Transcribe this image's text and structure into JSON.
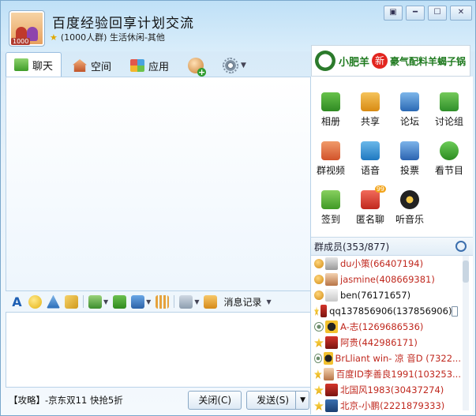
{
  "header": {
    "title": "百度经验回享计划交流",
    "avatar_badge": "1000",
    "group_info": "(1000人群) 生活休闲-其他"
  },
  "window_buttons": [
    "▣",
    "━",
    "☐",
    "✕"
  ],
  "tabs": [
    {
      "label": "聊天",
      "icon": "chat-icon"
    },
    {
      "label": "空间",
      "icon": "house-icon"
    },
    {
      "label": "应用",
      "icon": "apps-icon"
    }
  ],
  "ad": {
    "brand": "小肥羊",
    "badge": "新",
    "slogan": "豪气配料羊蝎子锅"
  },
  "apps": [
    {
      "label": "相册",
      "icon": "album-icon"
    },
    {
      "label": "共享",
      "icon": "folder-icon"
    },
    {
      "label": "论坛",
      "icon": "forum-icon"
    },
    {
      "label": "讨论组",
      "icon": "discussion-icon"
    },
    {
      "label": "群视频",
      "icon": "video-icon"
    },
    {
      "label": "语音",
      "icon": "voice-icon"
    },
    {
      "label": "投票",
      "icon": "vote-icon"
    },
    {
      "label": "看节目",
      "icon": "show-icon"
    },
    {
      "label": "签到",
      "icon": "checkin-icon"
    },
    {
      "label": "匿名聊",
      "icon": "anonymous-icon"
    },
    {
      "label": "听音乐",
      "icon": "music-icon"
    }
  ],
  "members": {
    "header": "群成员(353/877)",
    "list": [
      {
        "name": "du小策(66407194)",
        "role": "owner",
        "color": "#c0291f"
      },
      {
        "name": "jasmine(408669381)",
        "role": "owner",
        "color": "#c0291f"
      },
      {
        "name": "ben(76171657)",
        "role": "owner",
        "color": "#111111"
      },
      {
        "name": "qq137856906(137856906)",
        "role": "admin",
        "color": "#111111"
      },
      {
        "name": "A-志(1269686536)",
        "role": "none",
        "color": "#c0291f"
      },
      {
        "name": "阿贵(442986171)",
        "role": "admin",
        "color": "#c0291f"
      },
      {
        "name": "BrLliant win- 凉 音D (7322...",
        "role": "none",
        "color": "#c0291f"
      },
      {
        "name": "百度ID李善良1991(103253...",
        "role": "admin",
        "color": "#c0291f"
      },
      {
        "name": "北国风1983(30437274)",
        "role": "admin",
        "color": "#c0291f"
      },
      {
        "name": "北京-小鹏(2221879333)",
        "role": "admin",
        "color": "#c0291f"
      }
    ]
  },
  "toolbar": {
    "record_label": "消息记录"
  },
  "bottom": {
    "promo": "【攻略】-京东双11 快抢5折",
    "close_label": "关闭(C)",
    "send_label": "发送(S)"
  }
}
